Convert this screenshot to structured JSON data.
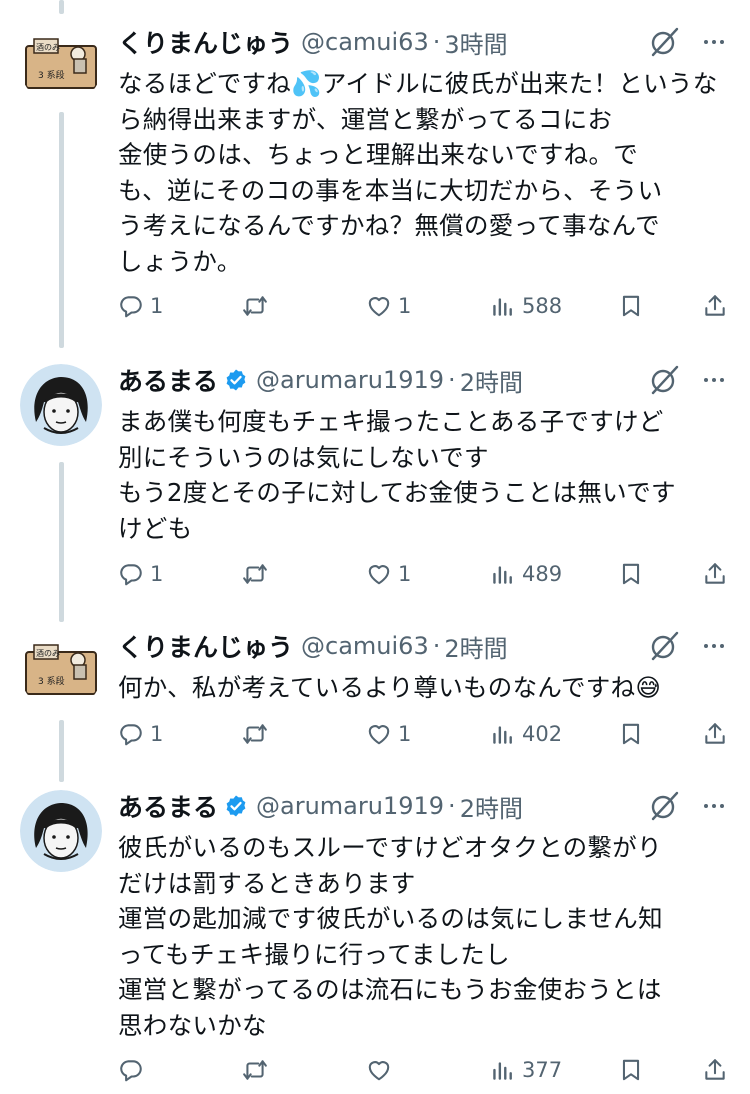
{
  "tweets": [
    {
      "name": "くりまんじゅう",
      "handle": "@camui63",
      "dot": "·",
      "time": "3時間",
      "verified": false,
      "avatar_icon": "manju-sign-avatar",
      "avatar_text": [
        "酒のみ",
        "3 系段"
      ],
      "text": "なるほどですね💦アイドルに彼氏が出来た！というなら納得出来ますが、運営と繋がってるコにお\n金使うのは、ちょっと理解出来ないですね。で\nも、逆にそのコの事を本当に大切だから、そうい\nう考えになるんですかね？無償の愛って事なんで\nしょうか。",
      "replies": "1",
      "reposts": "",
      "likes": "1",
      "views": "588"
    },
    {
      "name": "あるまる",
      "handle": "@arumaru1919",
      "dot": "·",
      "time": "2時間",
      "verified": true,
      "avatar_icon": "face-sketch-avatar",
      "text": "まあ僕も何度もチェキ撮ったことある子ですけど\n別にそういうのは気にしないです\nもう2度とその子に対してお金使うことは無いです\nけども",
      "replies": "1",
      "reposts": "",
      "likes": "1",
      "views": "489"
    },
    {
      "name": "くりまんじゅう",
      "handle": "@camui63",
      "dot": "·",
      "time": "2時間",
      "verified": false,
      "avatar_icon": "manju-sign-avatar",
      "avatar_text": [
        "酒のみ",
        "3 系段"
      ],
      "text": "何か、私が考えているより尊いものなんですね😅",
      "replies": "1",
      "reposts": "",
      "likes": "1",
      "views": "402"
    },
    {
      "name": "あるまる",
      "handle": "@arumaru1919",
      "dot": "·",
      "time": "2時間",
      "verified": true,
      "avatar_icon": "face-sketch-avatar",
      "text": "彼氏がいるのもスルーですけどオタクとの繋がり\nだけは罰するときあります\n運営の匙加減です彼氏がいるのは気にしません知\nってもチェキ撮りに行ってましたし\n運営と繋がってるのは流石にもうお金使おうとは\n思わないかな",
      "replies": "",
      "reposts": "",
      "likes": "",
      "views": "377"
    }
  ],
  "icons": {
    "reply": "reply-icon",
    "repost": "repost-icon",
    "like": "like-icon",
    "views": "views-icon",
    "bookmark": "bookmark-icon",
    "share": "share-icon",
    "grok": "grok-icon",
    "more": "more-icon",
    "verified": "verified-badge-icon"
  },
  "colors": {
    "text": "#0f1419",
    "secondary": "#536471",
    "verified": "#1d9bf0",
    "thread_line": "#cfd9de"
  }
}
